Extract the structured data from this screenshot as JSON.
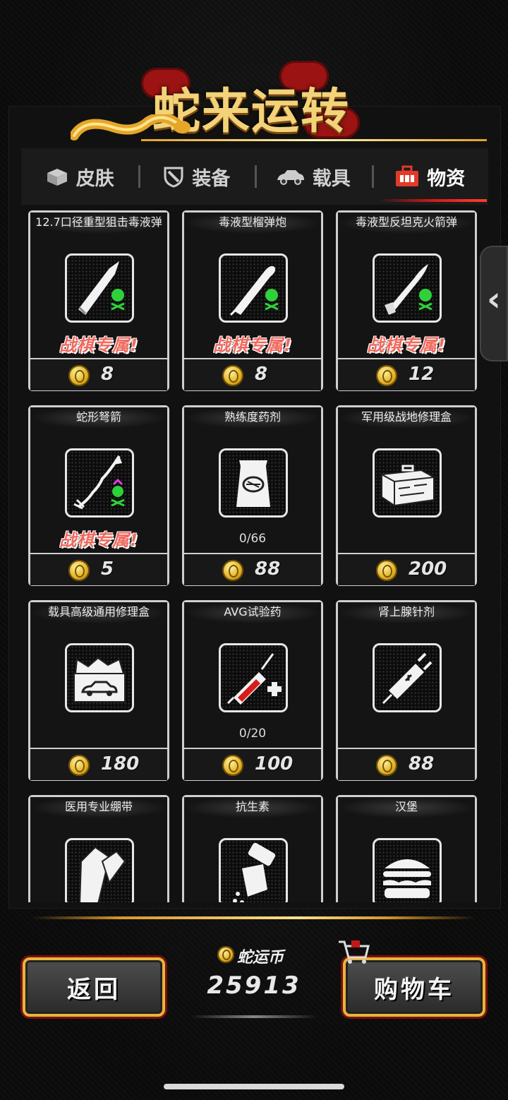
{
  "event": {
    "title": "蛇来运转"
  },
  "tabs": [
    {
      "label": "皮肤",
      "icon": "skin-box-icon"
    },
    {
      "label": "装备",
      "icon": "equipment-shield-icon"
    },
    {
      "label": "载具",
      "icon": "vehicle-car-icon"
    },
    {
      "label": "物资",
      "icon": "supplies-crate-icon",
      "active": true
    }
  ],
  "items": [
    {
      "name": "12.7口径重型狙击毒液弹",
      "icon": "bullet-poison-icon",
      "badge": "战棋专属!",
      "price": "8"
    },
    {
      "name": "毒液型榴弹炮",
      "icon": "grenade-shell-poison-icon",
      "badge": "战棋专属!",
      "price": "8"
    },
    {
      "name": "毒液型反坦克火箭弹",
      "icon": "rocket-poison-icon",
      "badge": "战棋专属!",
      "price": "12"
    },
    {
      "name": "蛇形弩箭",
      "icon": "snake-arrow-icon",
      "badge": "战棋专属!",
      "price": "5"
    },
    {
      "name": "熟练度药剂",
      "icon": "proficiency-potion-bag-icon",
      "progress": "0/66",
      "price": "88"
    },
    {
      "name": "军用级战地修理盒",
      "icon": "field-toolbox-icon",
      "price": "200"
    },
    {
      "name": "载具高级通用修理盒",
      "icon": "vehicle-repair-box-icon",
      "price": "180"
    },
    {
      "name": "AVG试验药",
      "icon": "syringe-plus-icon",
      "progress": "0/20",
      "price": "100"
    },
    {
      "name": "肾上腺针剂",
      "icon": "adrenaline-syringe-icon",
      "price": "88"
    },
    {
      "name": "医用专业绷带",
      "icon": "bandage-icon"
    },
    {
      "name": "抗生素",
      "icon": "pill-bottle-icon"
    },
    {
      "name": "汉堡",
      "icon": "burger-icon"
    }
  ],
  "footer": {
    "back_label": "返回",
    "currency_label": "蛇运币",
    "currency_value": "25913",
    "cart_label": "购物车"
  },
  "side_handle": {
    "glyph": "‹"
  },
  "colors": {
    "accent_gold": "#e8b43a",
    "accent_red": "#d21a1a",
    "badge_red": "#f06a5f"
  }
}
